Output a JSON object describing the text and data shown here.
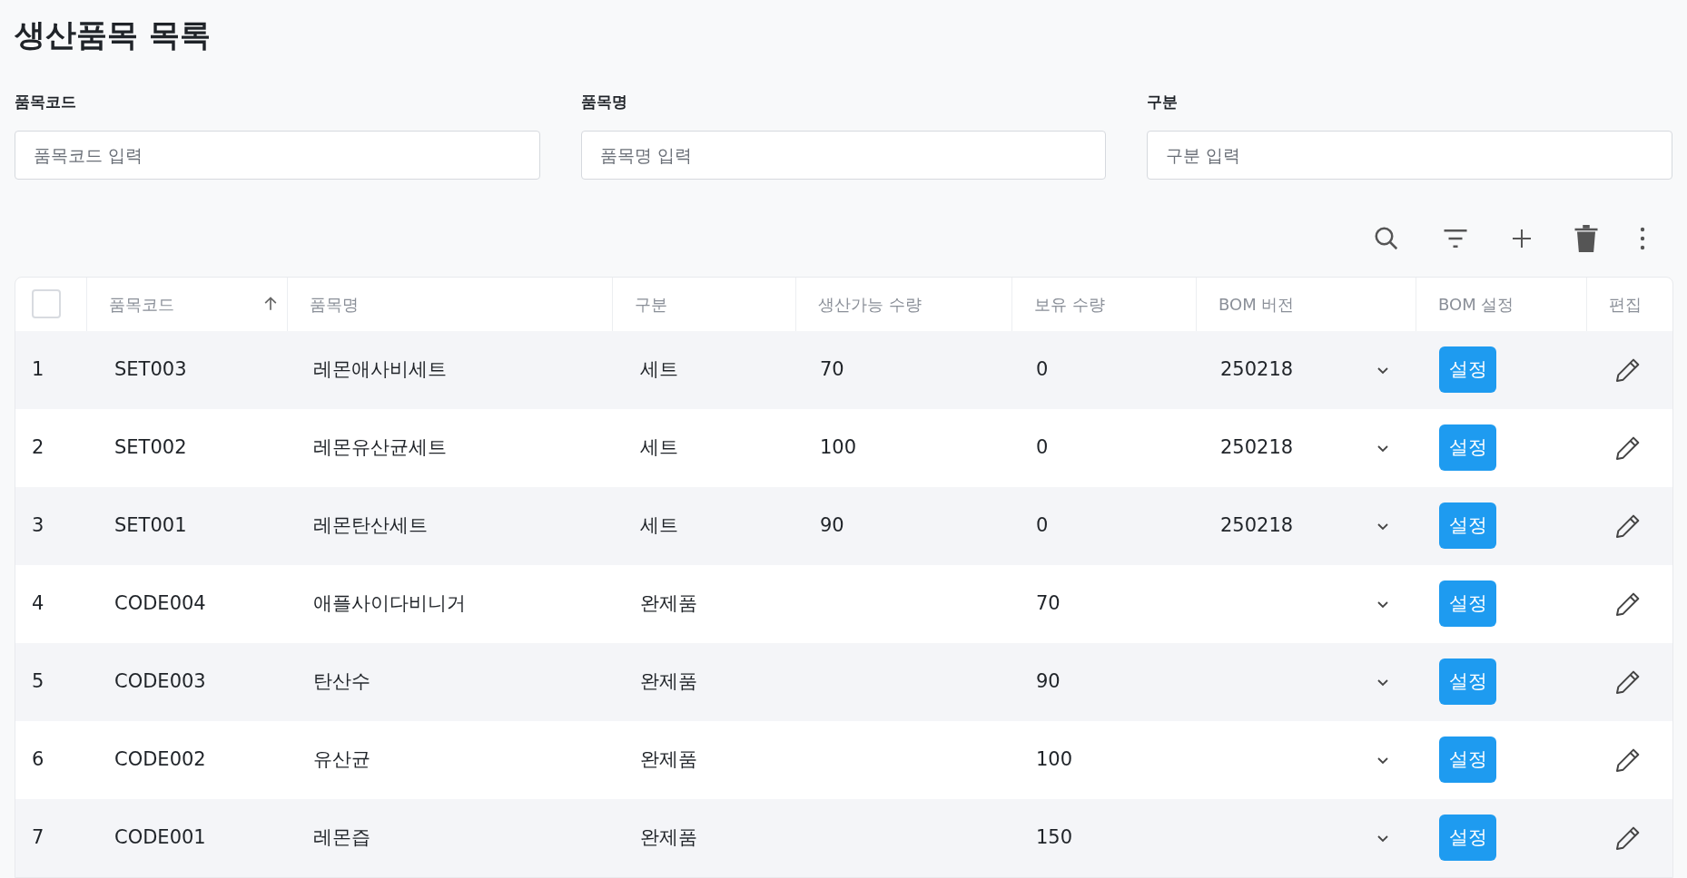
{
  "title": "생산품목 목록",
  "filters": [
    {
      "label": "품목코드",
      "placeholder": "품목코드 입력"
    },
    {
      "label": "품목명",
      "placeholder": "품목명 입력"
    },
    {
      "label": "구분",
      "placeholder": "구분 입력"
    }
  ],
  "table": {
    "select_all": {
      "checked": false
    },
    "columns": [
      {
        "label": "품목코드",
        "sorted": true
      },
      {
        "label": "품목명",
        "sorted": false
      },
      {
        "label": "구분",
        "sorted": false
      },
      {
        "label": "생산가능 수량",
        "sorted": false
      },
      {
        "label": "보유 수량",
        "sorted": false
      },
      {
        "label": "BOM 버전",
        "sorted": false
      },
      {
        "label": "BOM 설정",
        "sorted": false
      },
      {
        "label": "편집",
        "sorted": false
      }
    ],
    "rows": [
      {
        "no": "1",
        "code": "SET003",
        "name": "레몬애사비세트",
        "type": "세트",
        "producible": "70",
        "stock": "0",
        "bom_version": "250218",
        "action": "설정"
      },
      {
        "no": "2",
        "code": "SET002",
        "name": "레몬유산균세트",
        "type": "세트",
        "producible": "100",
        "stock": "0",
        "bom_version": "250218",
        "action": "설정"
      },
      {
        "no": "3",
        "code": "SET001",
        "name": "레몬탄산세트",
        "type": "세트",
        "producible": "90",
        "stock": "0",
        "bom_version": "250218",
        "action": "설정"
      },
      {
        "no": "4",
        "code": "CODE004",
        "name": "애플사이다비니거",
        "type": "완제품",
        "stock": "70",
        "action": "설정"
      },
      {
        "no": "5",
        "code": "CODE003",
        "name": "탄산수",
        "type": "완제품",
        "stock": "90",
        "action": "설정"
      },
      {
        "no": "6",
        "code": "CODE002",
        "name": "유산균",
        "type": "완제품",
        "stock": "100",
        "action": "설정"
      },
      {
        "no": "7",
        "code": "CODE001",
        "name": "레몬즙",
        "type": "완제품",
        "stock": "150",
        "action": "설정"
      }
    ]
  }
}
